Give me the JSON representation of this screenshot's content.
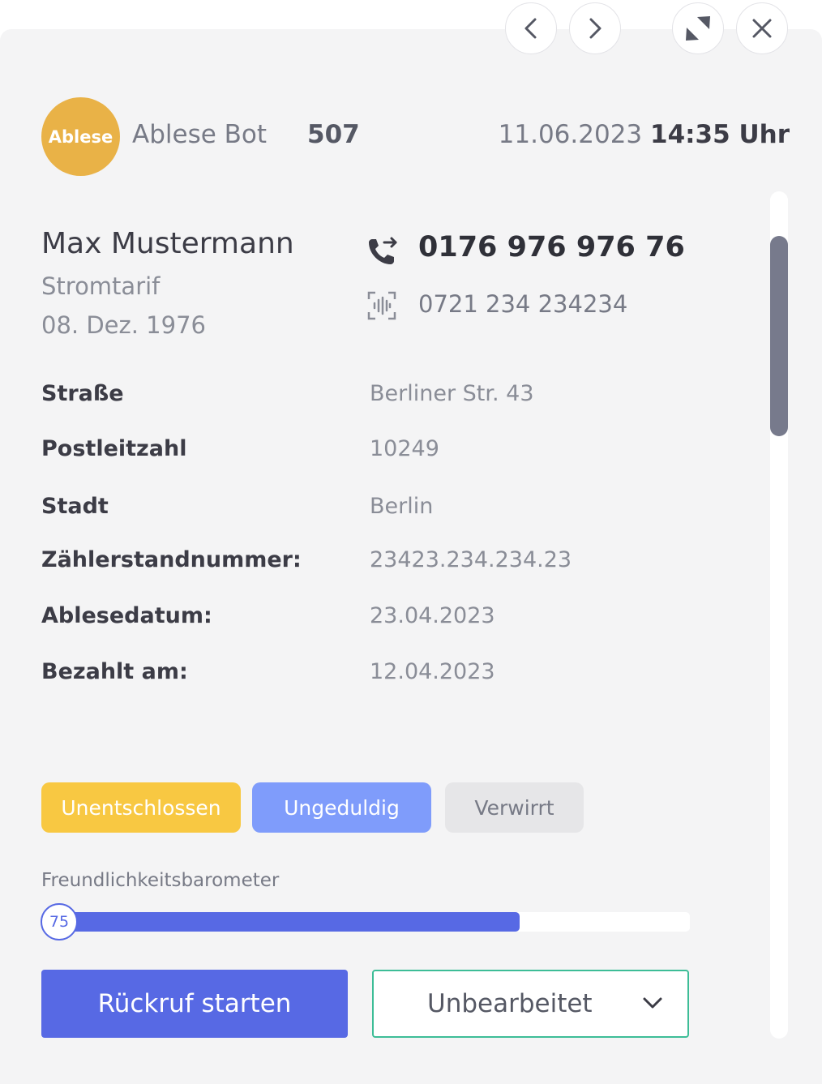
{
  "nav": {
    "prev_icon": "chevron-left-icon",
    "next_icon": "chevron-right-icon",
    "collapse_icon": "collapse-arrows-icon",
    "close_icon": "close-icon"
  },
  "header": {
    "avatar_label": "Ablese",
    "bot_name": "Ablese Bot",
    "bot_number": "507",
    "date": "11.06.2023",
    "time": "14:35 Uhr"
  },
  "customer": {
    "name": "Max Mustermann",
    "tarif": "Stromtarif",
    "birthdate": "08. Dez. 1976",
    "phone_main": "0176 976 976 76",
    "phone_alt": "0721 234 234234"
  },
  "details": [
    {
      "label": "Straße",
      "value": "Berliner Str. 43"
    },
    {
      "label": "Postleitzahl",
      "value": "10249"
    },
    {
      "label": "Stadt",
      "value": "Berlin"
    },
    {
      "label": "Zählerstandnummer:",
      "value": "23423.234.234.23"
    },
    {
      "label": "Ablesedatum:",
      "value": "23.04.2023"
    },
    {
      "label": "Bezahlt am:",
      "value": "12.04.2023"
    }
  ],
  "tags": [
    {
      "label": "Unentschlossen",
      "color": "#f8c842"
    },
    {
      "label": "Ungeduldig",
      "color": "#7f9cfb"
    },
    {
      "label": "Verwirrt",
      "color": "#e6e6e8"
    }
  ],
  "barometer": {
    "label": "Freundlichkeitsbarometer",
    "value": "75",
    "fill_percent": 73
  },
  "actions": {
    "callback_label": "Rückruf starten",
    "status_value": "Unbearbeitet"
  },
  "colors": {
    "accent": "#5769e4",
    "avatar": "#e9b247",
    "status_border": "#3dbd97",
    "scrollbar_thumb": "#777a8c"
  }
}
